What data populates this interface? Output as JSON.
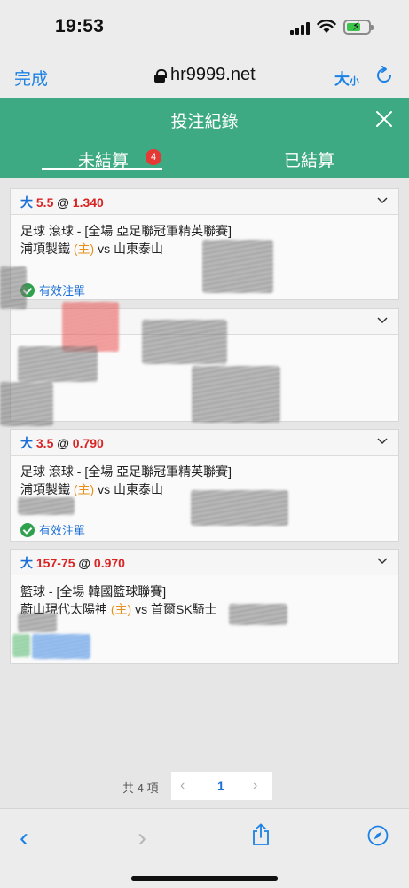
{
  "status": {
    "time": "19:53"
  },
  "browser": {
    "done_label": "完成",
    "url": "hr9999.net",
    "text_size_big": "大",
    "text_size_small": "小"
  },
  "header": {
    "title": "投注紀錄"
  },
  "tabs": {
    "pending_label": "未結算",
    "pending_count": "4",
    "settled_label": "已結算"
  },
  "bets": [
    {
      "side": "大",
      "handicap": "5.5",
      "at": "@",
      "odds": "1.340",
      "league": "足球 滾球 - [全場 亞足聯冠軍精英聯賽]",
      "home": "浦項製鐵",
      "home_tag": "(主)",
      "vs": "vs",
      "away": "山東泰山",
      "status": "有效注單"
    },
    {
      "side": "",
      "handicap": "",
      "at": "",
      "odds": "",
      "league": "",
      "home": "",
      "home_tag": "",
      "vs": "",
      "away": "",
      "status": ""
    },
    {
      "side": "大",
      "handicap": "3.5",
      "at": "@",
      "odds": "0.790",
      "league": "足球 滾球 - [全場 亞足聯冠軍精英聯賽]",
      "home": "浦項製鐵",
      "home_tag": "(主)",
      "vs": "vs",
      "away": "山東泰山",
      "status": "有效注單"
    },
    {
      "side": "大",
      "handicap": "157-75",
      "at": "@",
      "odds": "0.970",
      "league": "籃球 - [全場 韓國籃球聯賽]",
      "home": "蔚山現代太陽神",
      "home_tag": "(主)",
      "vs": "vs",
      "away": "首爾SK騎士",
      "status": ""
    }
  ],
  "pagination": {
    "total": "共 4 項",
    "prev": "‹",
    "page": "1",
    "next": "›"
  },
  "toolbar": {
    "back": "‹",
    "forward": "›"
  },
  "colors": {
    "accent_green": "#3daa84",
    "link_blue": "#1a82e6",
    "odds_red": "#d92424",
    "home_orange": "#e8901a"
  }
}
